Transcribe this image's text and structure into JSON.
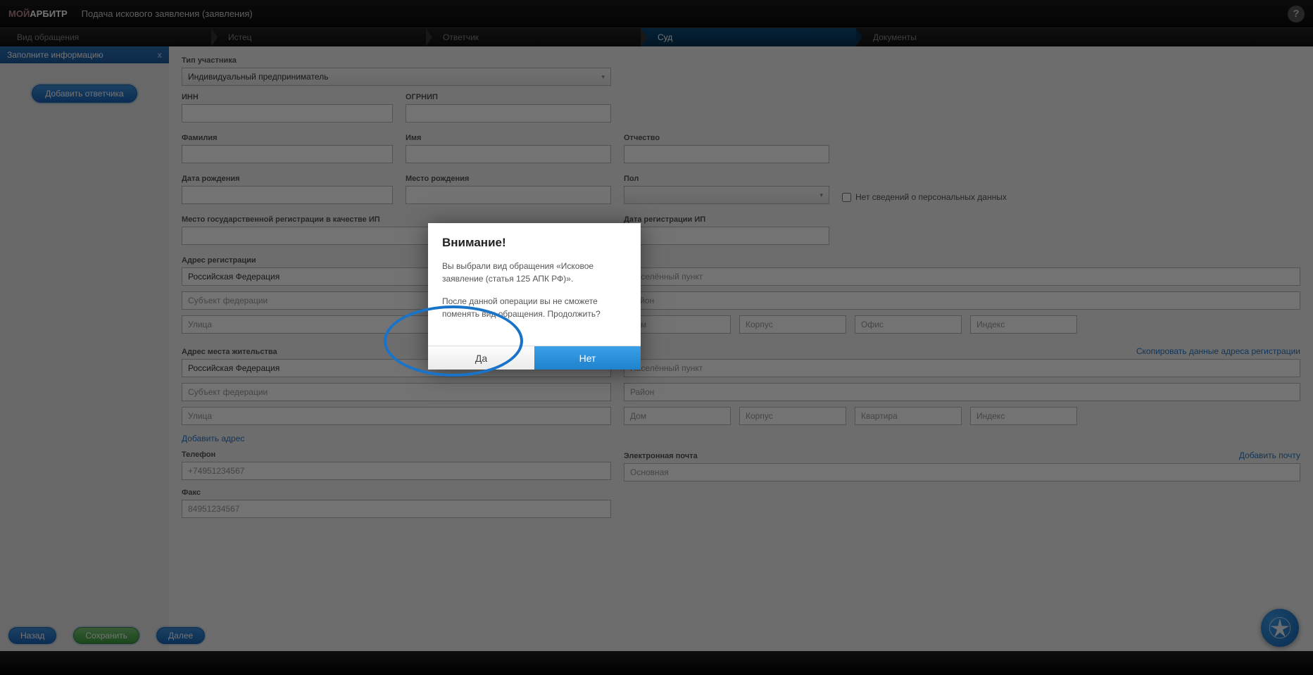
{
  "header": {
    "logo_part1": "МОЙ",
    "logo_part2": "АРБИТР",
    "title": "Подача искового заявления (заявления)"
  },
  "steps": {
    "s1": "Вид обращения",
    "s2": "Истец",
    "s3": "Ответчик",
    "s4": "Суд",
    "s5": "Документы"
  },
  "sidebar": {
    "header": "Заполните информацию",
    "close": "x",
    "add_defendant": "Добавить ответчика"
  },
  "form": {
    "participant_type_label": "Тип участника",
    "participant_type_value": "Индивидуальный предприниматель",
    "inn_label": "ИНН",
    "ogrnip_label": "ОГРНИП",
    "surname_label": "Фамилия",
    "name_label": "Имя",
    "patronymic_label": "Отчество",
    "birthdate_label": "Дата рождения",
    "birthplace_label": "Место рождения",
    "sex_label": "Пол",
    "no_personal_data": "Нет сведений о персональных данных",
    "reg_place_label": "Место государственной регистрации в качестве ИП",
    "reg_date_label": "Дата регистрации ИП",
    "reg_addr_label": "Адрес регистрации",
    "country_value": "Российская Федерация",
    "subject_ph": "Субъект федерации",
    "locality_ph": "Населённый пункт",
    "district_ph": "Район",
    "street_ph": "Улица",
    "house_ph": "Дом",
    "building_ph": "Корпус",
    "office_ph": "Офис",
    "apartment_ph": "Квартира",
    "index_ph": "Индекс",
    "live_addr_label": "Адрес места жительства",
    "copy_addr_link": "Скопировать данные адреса регистрации",
    "add_addr_link": "Добавить адрес",
    "phone_label": "Телефон",
    "phone_ph": "+74951234567",
    "email_label": "Электронная почта",
    "email_ph": "Основная",
    "add_email_link": "Добавить почту",
    "fax_label": "Факс",
    "fax_ph": "84951234567"
  },
  "buttons": {
    "back": "Назад",
    "save": "Сохранить",
    "next": "Далее"
  },
  "modal": {
    "title": "Внимание!",
    "line1": "Вы выбрали вид обращения «Исковое заявление (статья 125 АПК РФ)».",
    "line2": "После данной операции вы не сможете поменять вид обращения. Продолжить?",
    "yes": "Да",
    "no": "Нет"
  }
}
